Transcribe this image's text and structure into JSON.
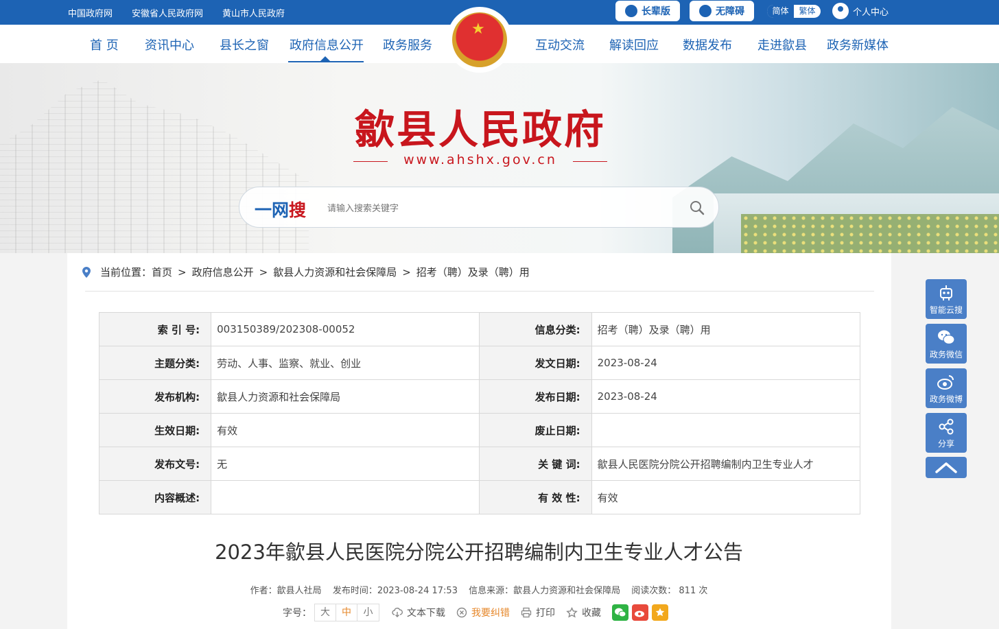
{
  "topbar": {
    "links": [
      "中国政府网",
      "安徽省人民政府网",
      "黄山市人民政府"
    ],
    "elder_label": "长辈版",
    "accessible_label": "无障碍",
    "lang_simplified": "简体",
    "lang_traditional": "繁体",
    "user_center": "个人中心"
  },
  "nav": {
    "items": [
      "首 页",
      "资讯中心",
      "县长之窗",
      "政府信息公开",
      "政务服务",
      "互动交流",
      "解读回应",
      "数据发布",
      "走进歙县",
      "政务新媒体"
    ],
    "active": "政府信息公开"
  },
  "banner": {
    "title": "歙县人民政府",
    "url": "www.ahshx.gov.cn",
    "search_logo_a": "一网",
    "search_logo_b": "搜",
    "search_placeholder": "请输入搜索关键字"
  },
  "breadcrumb": {
    "label": "当前位置：",
    "items": [
      "首页",
      "政府信息公开",
      "歙县人力资源和社会保障局",
      "招考（聘）及录（聘）用"
    ],
    "separator": ">"
  },
  "meta": {
    "rows": [
      [
        {
          "k": "索 引 号:",
          "v": "003150389/202308-00052"
        },
        {
          "k": "信息分类:",
          "v": "招考（聘）及录（聘）用"
        }
      ],
      [
        {
          "k": "主题分类:",
          "v": "劳动、人事、监察、就业、创业"
        },
        {
          "k": "发文日期:",
          "v": "2023-08-24"
        }
      ],
      [
        {
          "k": "发布机构:",
          "v": "歙县人力资源和社会保障局"
        },
        {
          "k": "发布日期:",
          "v": "2023-08-24"
        }
      ],
      [
        {
          "k": "生效日期:",
          "v": "有效"
        },
        {
          "k": "废止日期:",
          "v": ""
        }
      ],
      [
        {
          "k": "发布文号:",
          "v": "无"
        },
        {
          "k": "关 键 词:",
          "v": "歙县人民医院分院公开招聘编制内卫生专业人才"
        }
      ],
      [
        {
          "k": "内容概述:",
          "v": ""
        },
        {
          "k": "有 效 性:",
          "v": "有效"
        }
      ]
    ]
  },
  "article": {
    "title": "2023年歙县人民医院分院公开招聘编制内卫生专业人才公告",
    "author": "作者：歙县人社局",
    "publish_time": "发布时间：2023-08-24 17:53",
    "source": "信息来源：歙县人力资源和社会保障局",
    "views": "阅读次数： 811 次"
  },
  "tools": {
    "font_label": "字号：",
    "font_sizes": [
      "大",
      "中",
      "小"
    ],
    "download": "文本下载",
    "correction": "我要纠错",
    "print": "打印",
    "favorite": "收藏"
  },
  "sidebar": {
    "items": [
      "智能云搜",
      "政务微信",
      "政务微博",
      "分享"
    ]
  },
  "colors": {
    "brand_blue": "#1d63b4",
    "title_red": "#c8161d",
    "side_blue": "#4a7fc7",
    "accent_orange": "#e6872a"
  }
}
